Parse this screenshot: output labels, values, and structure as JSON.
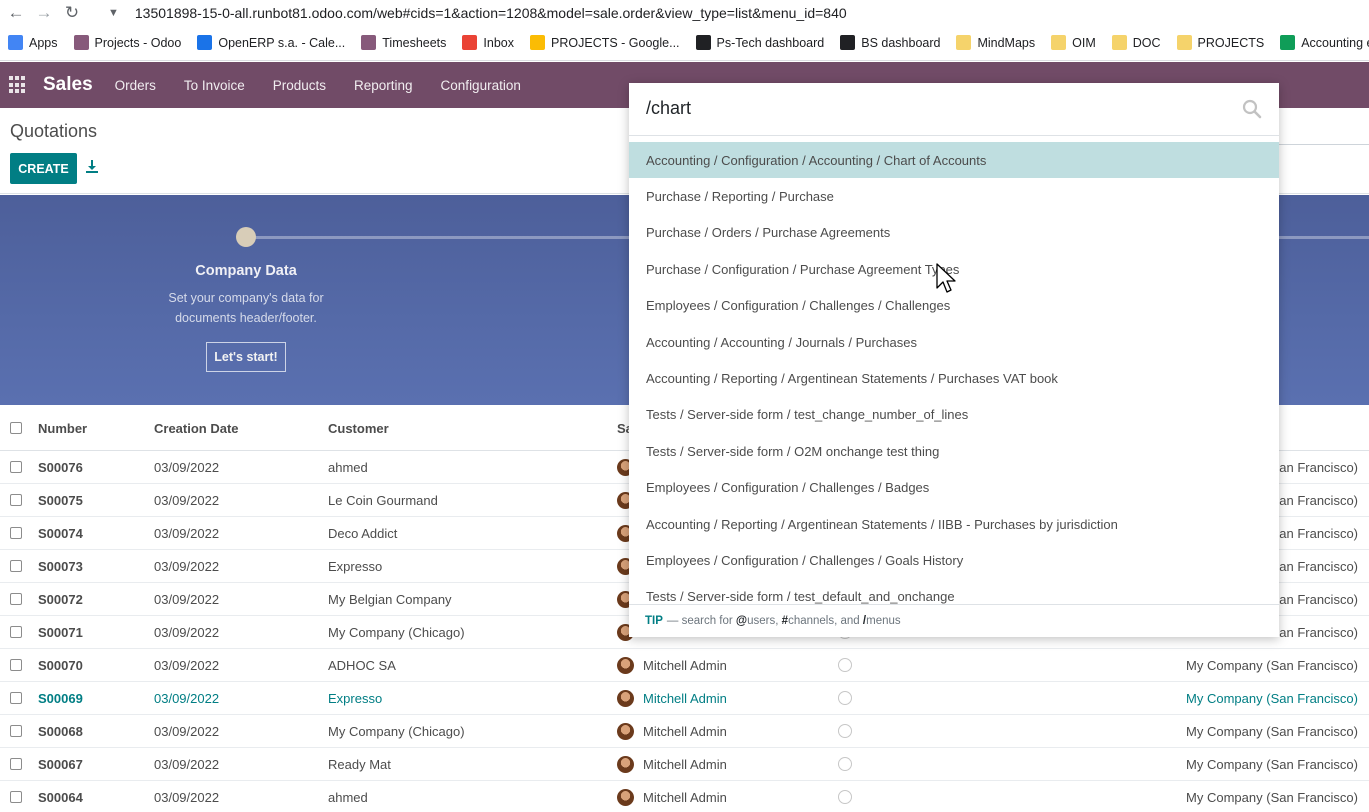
{
  "browser": {
    "url": "13501898-15-0-all.runbot81.odoo.com/web#cids=1&action=1208&model=sale.order&view_type=list&menu_id=840",
    "bookmarks": [
      {
        "label": "Apps",
        "color": "#4285f4"
      },
      {
        "label": "Projects - Odoo",
        "color": "#875a7b"
      },
      {
        "label": "OpenERP s.a. - Cale...",
        "color": "#1a73e8"
      },
      {
        "label": "Timesheets",
        "color": "#875a7b"
      },
      {
        "label": "Inbox",
        "color": "#ea4335"
      },
      {
        "label": "PROJECTS - Google...",
        "color": "#fbbc04"
      },
      {
        "label": "Ps-Tech dashboard",
        "color": "#202124"
      },
      {
        "label": "BS dashboard",
        "color": "#202124"
      },
      {
        "label": "MindMaps",
        "color": "#f5d36b"
      },
      {
        "label": "OIM",
        "color": "#f5d36b"
      },
      {
        "label": "DOC",
        "color": "#f5d36b"
      },
      {
        "label": "PROJECTS",
        "color": "#f5d36b"
      },
      {
        "label": "Accounting expert",
        "color": "#0f9d58"
      }
    ]
  },
  "navbar": {
    "brand": "Sales",
    "menu": [
      "Orders",
      "To Invoice",
      "Products",
      "Reporting",
      "Configuration"
    ],
    "color": "#714b67"
  },
  "control_panel": {
    "breadcrumb": "Quotations",
    "create_label": "CREATE"
  },
  "onboarding": {
    "step_title": "Company Data",
    "step_desc": "Set your company's data for documents header/footer.",
    "step_button": "Let's start!"
  },
  "list": {
    "columns": [
      "Number",
      "Creation Date",
      "Customer",
      "Sa"
    ],
    "rows": [
      {
        "number": "S00076",
        "date": "03/09/2022",
        "customer": "ahmed",
        "salesperson": "",
        "company": "an Francisco)"
      },
      {
        "number": "S00075",
        "date": "03/09/2022",
        "customer": "Le Coin Gourmand",
        "salesperson": "",
        "company": "an Francisco)"
      },
      {
        "number": "S00074",
        "date": "03/09/2022",
        "customer": "Deco Addict",
        "salesperson": "",
        "company": "an Francisco)"
      },
      {
        "number": "S00073",
        "date": "03/09/2022",
        "customer": "Expresso",
        "salesperson": "",
        "company": "an Francisco)"
      },
      {
        "number": "S00072",
        "date": "03/09/2022",
        "customer": "My Belgian Company",
        "salesperson": "",
        "company": "an Francisco)"
      },
      {
        "number": "S00071",
        "date": "03/09/2022",
        "customer": "My Company (Chicago)",
        "salesperson": "",
        "company": "an Francisco)"
      },
      {
        "number": "S00070",
        "date": "03/09/2022",
        "customer": "ADHOC SA",
        "salesperson": "Mitchell Admin",
        "company": "My Company (San Francisco)"
      },
      {
        "number": "S00069",
        "date": "03/09/2022",
        "customer": "Expresso",
        "salesperson": "Mitchell Admin",
        "company": "My Company (San Francisco)",
        "active": true
      },
      {
        "number": "S00068",
        "date": "03/09/2022",
        "customer": "My Company (Chicago)",
        "salesperson": "Mitchell Admin",
        "company": "My Company (San Francisco)"
      },
      {
        "number": "S00067",
        "date": "03/09/2022",
        "customer": "Ready Mat",
        "salesperson": "Mitchell Admin",
        "company": "My Company (San Francisco)"
      },
      {
        "number": "S00064",
        "date": "03/09/2022",
        "customer": "ahmed",
        "salesperson": "Mitchell Admin",
        "company": "My Company (San Francisco)"
      }
    ]
  },
  "palette": {
    "query": "/chart",
    "items": [
      "Accounting / Configuration / Accounting / Chart of Accounts",
      "Purchase / Reporting / Purchase",
      "Purchase / Orders / Purchase Agreements",
      "Purchase / Configuration / Purchase Agreement Types",
      "Employees / Configuration / Challenges / Challenges",
      "Accounting / Accounting / Journals / Purchases",
      "Accounting / Reporting / Argentinean Statements / Purchases VAT book",
      "Tests / Server-side form / test_change_number_of_lines",
      "Tests / Server-side form / O2M onchange test thing",
      "Employees / Configuration / Challenges / Badges",
      "Accounting / Reporting / Argentinean Statements / IIBB - Purchases by jurisdiction",
      "Employees / Configuration / Challenges / Goals History",
      "Tests / Server-side form / test_default_and_onchange"
    ],
    "selected_index": 0,
    "tip_label": "TIP",
    "tip_text_1": "— search for ",
    "tip_users": "@",
    "tip_text_2": "users, ",
    "tip_channels": "#",
    "tip_text_3": "channels, and ",
    "tip_menus": "/",
    "tip_text_4": "menus"
  }
}
